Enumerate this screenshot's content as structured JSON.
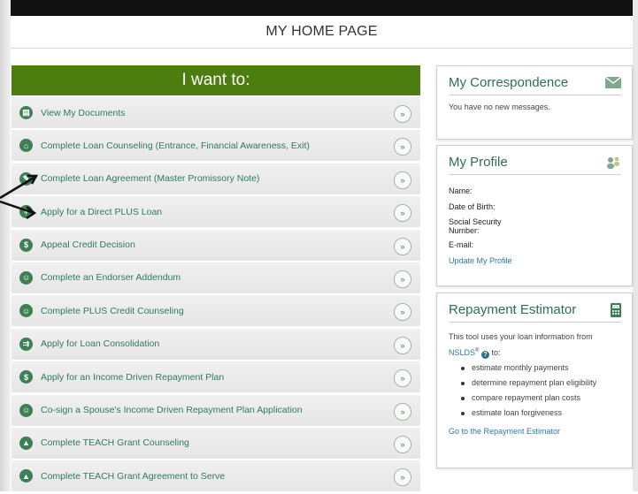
{
  "page_title": "MY HOME PAGE",
  "i_want_to": {
    "title": "I want to:",
    "actions": [
      {
        "label": "View My Documents",
        "icon": "document-icon"
      },
      {
        "label": "Complete Loan Counseling (Entrance, Financial Awareness, Exit)",
        "icon": "home-icon"
      },
      {
        "label": "Complete Loan Agreement (Master Promissory Note)",
        "icon": "signature-icon"
      },
      {
        "label": "Apply for a Direct PLUS Loan",
        "icon": "plus-loan-icon"
      },
      {
        "label": "Appeal Credit Decision",
        "icon": "dollar-circle-icon"
      },
      {
        "label": "Complete an Endorser Addendum",
        "icon": "people-icon"
      },
      {
        "label": "Complete PLUS Credit Counseling",
        "icon": "people-icon"
      },
      {
        "label": "Apply for Loan Consolidation",
        "icon": "consolidation-icon"
      },
      {
        "label": "Apply for an Income Driven Repayment Plan",
        "icon": "dollar-sign-icon"
      },
      {
        "label": "Co-sign a Spouse's Income Driven Repayment Plan Application",
        "icon": "people-icon"
      },
      {
        "label": "Complete TEACH Grant Counseling",
        "icon": "graduation-cap-icon"
      },
      {
        "label": "Complete TEACH Grant Agreement to Serve",
        "icon": "graduation-cap-icon"
      }
    ]
  },
  "correspondence": {
    "title": "My Correspondence",
    "message": "You have no new messages."
  },
  "profile": {
    "title": "My Profile",
    "name_label": "Name:",
    "dob_label": "Date of Birth:",
    "ssn_label": "Social Security Number:",
    "email_label": "E-mail:",
    "update_link": "Update My Profile"
  },
  "estimator": {
    "title": "Repayment Estimator",
    "intro": "This tool uses your loan information from",
    "nslds": "NSLDS",
    "nslds_sup": "®",
    "to_text": "to:",
    "bullets": [
      "estimate monthly payments",
      "determine repayment plan eligibility",
      "compare repayment plan costs",
      "estimate loan forgiveness"
    ],
    "link": "Go to the Repayment Estimator"
  },
  "colors": {
    "title_bar_green": "#4d7d0f",
    "link_green": "#2f7a5a",
    "link_blue": "#2d7aa3"
  }
}
